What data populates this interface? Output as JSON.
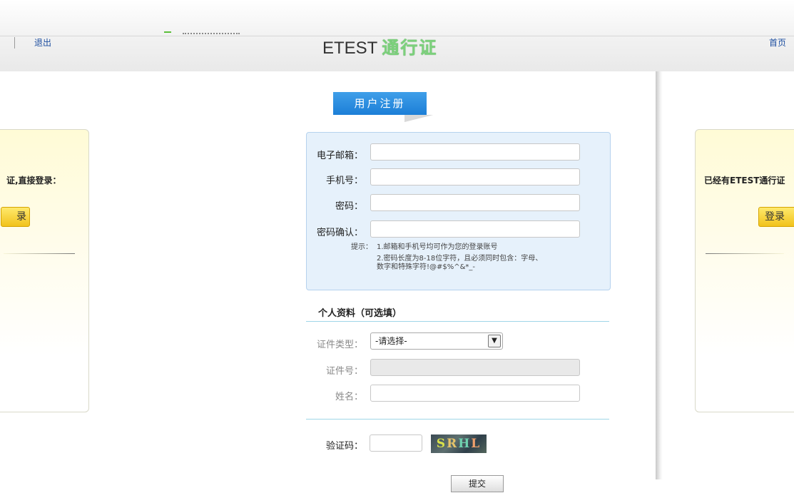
{
  "header": {
    "logout_label": "退出",
    "brand_etest": "ETEST",
    "brand_pass": "通行证",
    "home_label": "首页"
  },
  "left_panel": {
    "prompt": "证,直接登录：",
    "button_label": "录"
  },
  "right_panel": {
    "prompt": "已经有ETEST通行证",
    "button_label": "登录"
  },
  "form": {
    "title": "用户注册",
    "email_label": "电子邮箱：",
    "email_value": "",
    "phone_label": "手机号：",
    "phone_value": "",
    "password_label": "密码：",
    "password_value": "",
    "confirm_label": "密码确认：",
    "confirm_value": "",
    "hint_prefix": "提示：",
    "hint_1": "1.邮箱和手机号均可作为您的登录账号",
    "hint_2a": "2.密码长度为8-18位字符，且必须同时包含：字母、",
    "hint_2b": "数字和特殊字符!@#$%^&*_-"
  },
  "profile": {
    "section_title": "个人资料（可选填）",
    "id_type_label": "证件类型：",
    "id_type_selected": "-请选择-",
    "id_number_label": "证件号：",
    "id_number_value": "",
    "name_label": "姓名：",
    "name_value": ""
  },
  "captcha": {
    "label": "验证码：",
    "value": "",
    "image_chars": [
      "S",
      "R",
      "H",
      "L"
    ]
  },
  "submit_label": "提交",
  "colors": {
    "tab_blue": "#2a8fe0",
    "form_bg": "#e6f1fb",
    "panel_yellow": "#fffbd6",
    "button_gold": "#f1c21b",
    "brand_green": "#7cd17c"
  }
}
